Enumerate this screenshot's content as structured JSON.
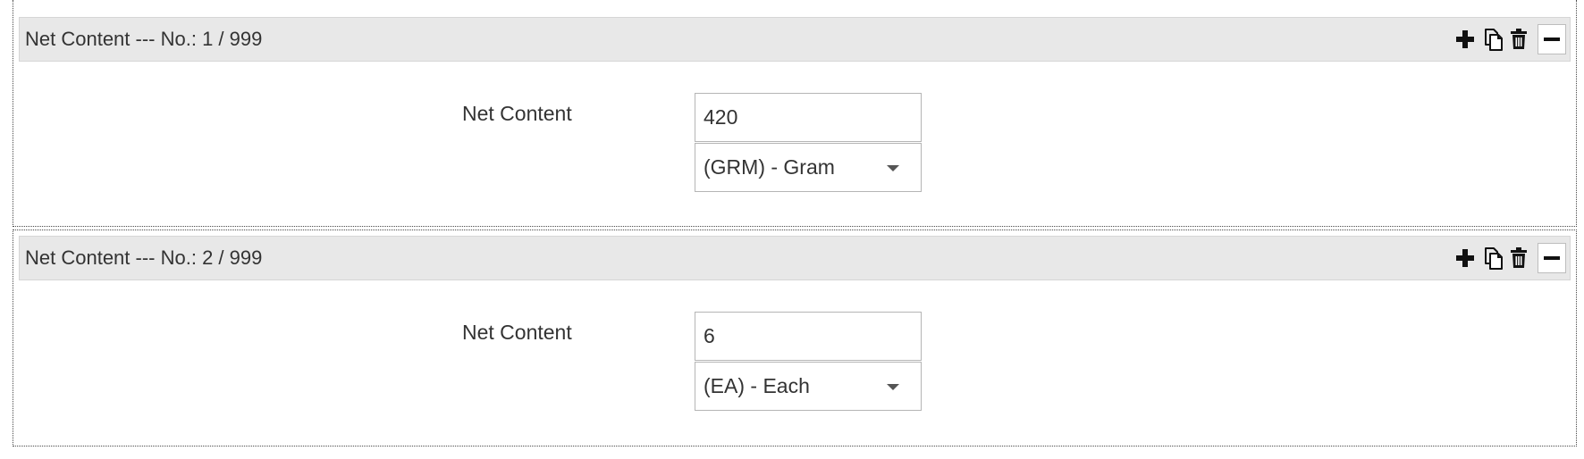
{
  "sections": [
    {
      "header": {
        "title": "Net Content --- No.: 1 / 999"
      },
      "field": {
        "label": "Net Content",
        "value": "420",
        "unit_selected": "(GRM) - Gram"
      }
    },
    {
      "header": {
        "title": "Net Content --- No.: 2 / 999"
      },
      "field": {
        "label": "Net Content",
        "value": "6",
        "unit_selected": "(EA) - Each"
      }
    }
  ],
  "toolbar_icons": [
    "plus-icon",
    "copy-icon",
    "trash-icon",
    "minus-icon"
  ],
  "colors": {
    "header_background": "#e8e8e8",
    "text": "#333333",
    "icon": "#111111",
    "border": "#b5b5b5"
  }
}
